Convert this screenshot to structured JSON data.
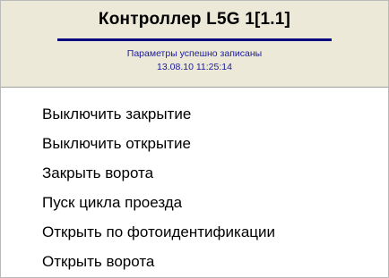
{
  "header": {
    "title": "Контроллер L5G 1[1.1]",
    "status_message": "Параметры успешно записаны",
    "status_timestamp": "13.08.10 11:25:14"
  },
  "menu": {
    "items": [
      {
        "label": "Выключить закрытие"
      },
      {
        "label": "Выключить открытие"
      },
      {
        "label": "Закрыть ворота"
      },
      {
        "label": "Пуск цикла проезда"
      },
      {
        "label": "Открыть по фотоидентификации"
      },
      {
        "label": "Открыть ворота"
      }
    ]
  },
  "colors": {
    "header_background": "#ece9d8",
    "title_rule": "#0a0a80",
    "status_text": "#1a1a9e"
  }
}
